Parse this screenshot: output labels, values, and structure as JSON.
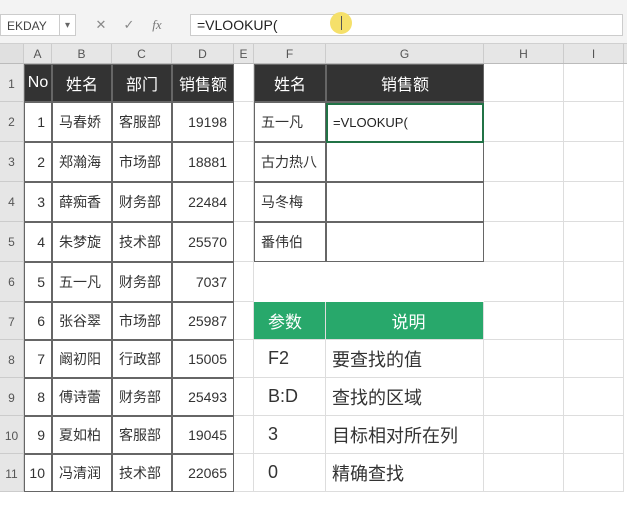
{
  "namebox": "EKDAY",
  "formula_bar": "=VLOOKUP(",
  "col_labels": [
    "A",
    "B",
    "C",
    "D",
    "E",
    "F",
    "G",
    "H",
    "I"
  ],
  "main_headers": {
    "no": "No",
    "name": "姓名",
    "dept": "部门",
    "sales": "销售额"
  },
  "lookup_headers": {
    "name": "姓名",
    "sales": "销售额"
  },
  "rows": [
    {
      "rh": "1",
      "no": "",
      "name": "",
      "dept": "",
      "sales": ""
    },
    {
      "rh": "2",
      "no": "1",
      "name": "马春娇",
      "dept": "客服部",
      "sales": "19198"
    },
    {
      "rh": "3",
      "no": "2",
      "name": "郑瀚海",
      "dept": "市场部",
      "sales": "18881"
    },
    {
      "rh": "4",
      "no": "3",
      "name": "薛痴香",
      "dept": "财务部",
      "sales": "22484"
    },
    {
      "rh": "5",
      "no": "4",
      "name": "朱梦旋",
      "dept": "技术部",
      "sales": "25570"
    },
    {
      "rh": "6",
      "no": "5",
      "name": "五一凡",
      "dept": "财务部",
      "sales": "7037"
    },
    {
      "rh": "7",
      "no": "6",
      "name": "张谷翠",
      "dept": "市场部",
      "sales": "25987"
    },
    {
      "rh": "8",
      "no": "7",
      "name": "阚初阳",
      "dept": "行政部",
      "sales": "15005"
    },
    {
      "rh": "9",
      "no": "8",
      "name": "傅诗蕾",
      "dept": "财务部",
      "sales": "25493"
    },
    {
      "rh": "10",
      "no": "9",
      "name": "夏如柏",
      "dept": "客服部",
      "sales": "19045"
    },
    {
      "rh": "11",
      "no": "10",
      "name": "冯清润",
      "dept": "技术部",
      "sales": "22065"
    }
  ],
  "lookup_names": [
    "五一凡",
    "古力热八",
    "马冬梅",
    "番伟伯"
  ],
  "g2_formula": "=VLOOKUP(",
  "param_header": "参数",
  "desc_header": "说明",
  "params": [
    {
      "p": "F2",
      "d": "要查找的值"
    },
    {
      "p": "B:D",
      "d": "查找的区域"
    },
    {
      "p": "3",
      "d": "目标相对所在列"
    },
    {
      "p": "0",
      "d": "精确查找"
    }
  ],
  "chart_data": {
    "type": "table",
    "title": "VLOOKUP 参数说明",
    "columns": [
      "参数",
      "说明"
    ],
    "rows": [
      [
        "F2",
        "要查找的值"
      ],
      [
        "B:D",
        "查找的区域"
      ],
      [
        "3",
        "目标相对所在列"
      ],
      [
        "0",
        "精确查找"
      ]
    ]
  }
}
